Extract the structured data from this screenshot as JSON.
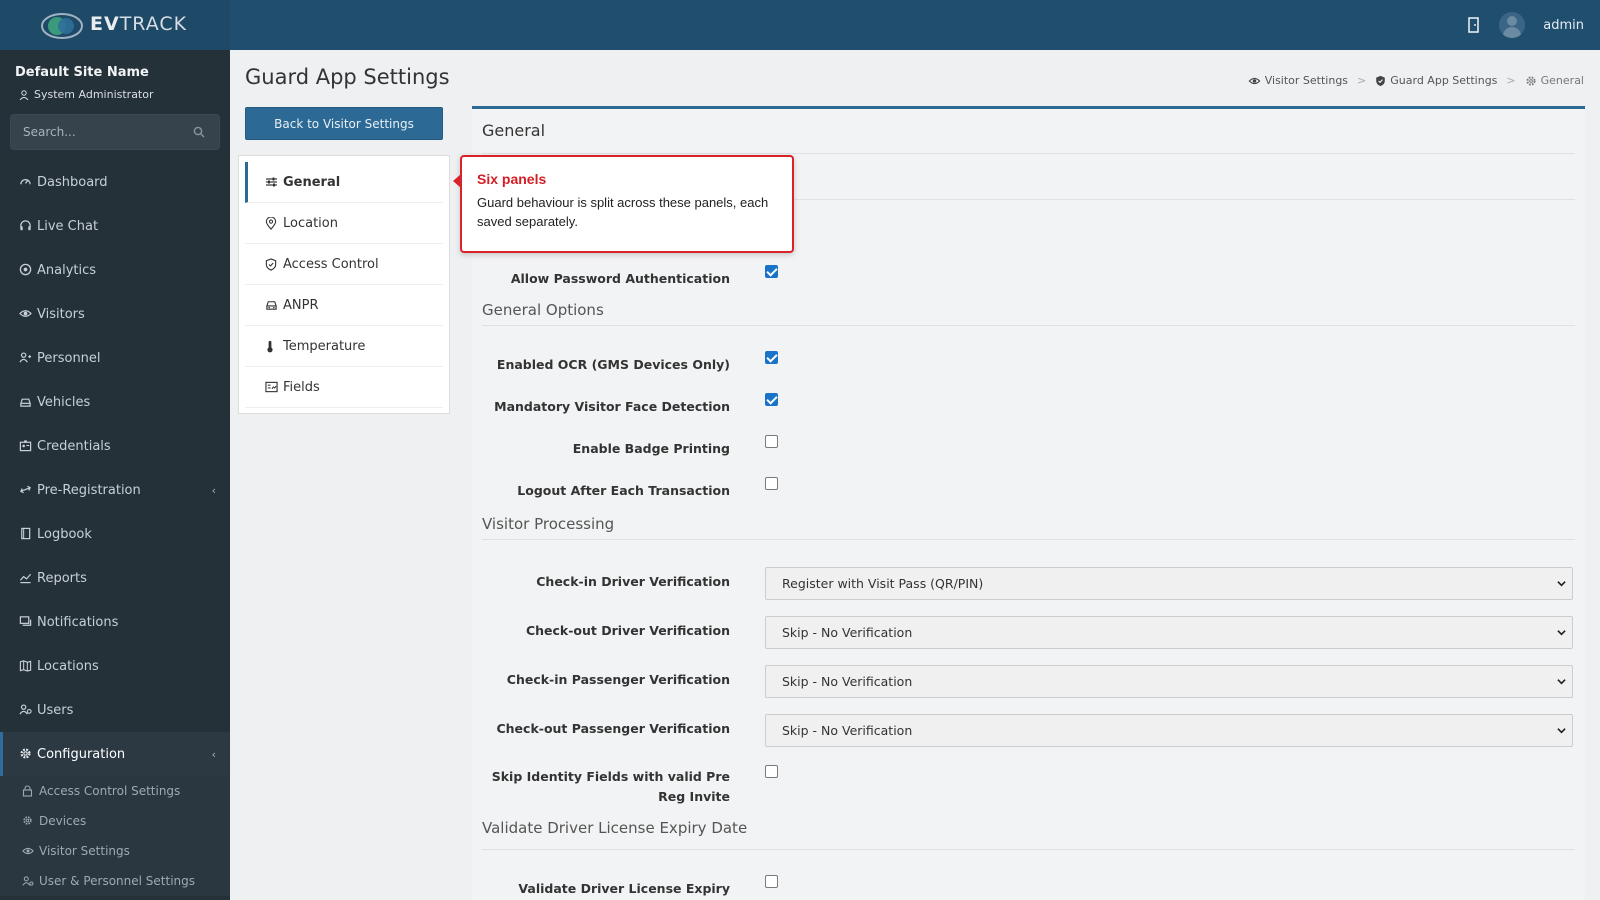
{
  "brand": {
    "logo_text_bold": "EV",
    "logo_text": "TRACK"
  },
  "topbar": {
    "user": "admin"
  },
  "sidebar": {
    "site_name": "Default Site Name",
    "role": "System Administrator",
    "search_placeholder": "Search...",
    "items": [
      {
        "label": "Dashboard",
        "icon": "dashboard-icon"
      },
      {
        "label": "Live Chat",
        "icon": "headset-icon"
      },
      {
        "label": "Analytics",
        "icon": "analytics-icon"
      },
      {
        "label": "Visitors",
        "icon": "eye-icon"
      },
      {
        "label": "Personnel",
        "icon": "personnel-icon"
      },
      {
        "label": "Vehicles",
        "icon": "car-icon"
      },
      {
        "label": "Credentials",
        "icon": "id-card-icon"
      },
      {
        "label": "Pre-Registration",
        "icon": "arrows-icon"
      },
      {
        "label": "Logbook",
        "icon": "book-icon"
      },
      {
        "label": "Reports",
        "icon": "chart-icon"
      },
      {
        "label": "Notifications",
        "icon": "chat-icon"
      },
      {
        "label": "Locations",
        "icon": "map-icon"
      },
      {
        "label": "Users",
        "icon": "users-icon"
      },
      {
        "label": "Configuration",
        "icon": "gear-icon"
      }
    ],
    "sub_items": [
      {
        "label": "Access Control Settings",
        "icon": "lock-icon"
      },
      {
        "label": "Devices",
        "icon": "gear-icon"
      },
      {
        "label": "Visitor Settings",
        "icon": "eye-icon"
      },
      {
        "label": "User & Personnel Settings",
        "icon": "user-settings-icon"
      }
    ]
  },
  "main": {
    "title": "Guard App Settings",
    "breadcrumb": [
      "Visitor Settings",
      "Guard App Settings",
      "General"
    ],
    "back_button": "Back to Visitor Settings",
    "panels": [
      "General",
      "Location",
      "Access Control",
      "ANPR",
      "Temperature",
      "Fields"
    ],
    "card_title": "General",
    "allow_password_auth": {
      "label": "Allow Password Authentication",
      "checked": true
    },
    "general_options": {
      "heading": "General Options",
      "rows": [
        {
          "label": "Enabled OCR (GMS Devices Only)",
          "checked": true
        },
        {
          "label": "Mandatory Visitor Face Detection",
          "checked": true
        },
        {
          "label": "Enable Badge Printing",
          "checked": false
        },
        {
          "label": "Logout After Each Transaction",
          "checked": false
        }
      ]
    },
    "visitor_processing": {
      "heading": "Visitor Processing",
      "rows": [
        {
          "label": "Check-in Driver Verification",
          "value": "Register with Visit Pass (QR/PIN)"
        },
        {
          "label": "Check-out Driver Verification",
          "value": "Skip - No Verification"
        },
        {
          "label": "Check-in Passenger Verification",
          "value": "Skip - No Verification"
        },
        {
          "label": "Check-out Passenger Verification",
          "value": "Skip - No Verification"
        }
      ],
      "skip_identity": {
        "label": "Skip Identity Fields with valid Pre Reg Invite",
        "checked": false
      }
    },
    "validate_license": {
      "heading": "Validate Driver License Expiry Date",
      "row": {
        "label": "Validate Driver License Expiry Date",
        "checked": false
      }
    }
  },
  "callout": {
    "title": "Six panels",
    "body": "Guard behaviour is split across these panels, each saved separately."
  },
  "colors": {
    "topbar": "#1f4e6e",
    "sidebar": "#253139",
    "accent": "#2c6a95",
    "callout_border": "#d9232b"
  }
}
